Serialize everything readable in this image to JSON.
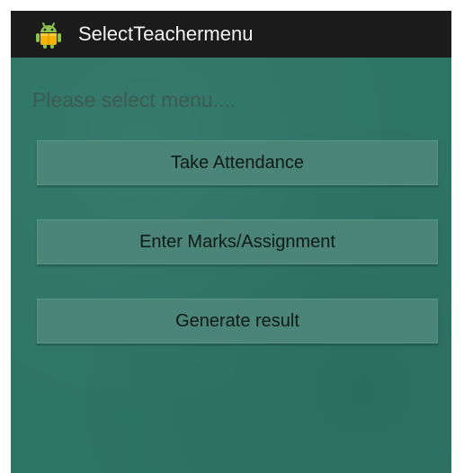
{
  "action_bar": {
    "title": "SelectTeachermenu",
    "icon": "android-robot-icon"
  },
  "main": {
    "prompt": "Please select menu....",
    "buttons": [
      {
        "label": "Take Attendance"
      },
      {
        "label": "Enter Marks/Assignment"
      },
      {
        "label": "Generate result"
      }
    ]
  },
  "colors": {
    "action_bar_bg": "#1b1b1b",
    "content_bg": "#2d7565",
    "button_bg": "#4a8577",
    "icon_accent": "#f4b400",
    "icon_green": "#8bc34a"
  }
}
